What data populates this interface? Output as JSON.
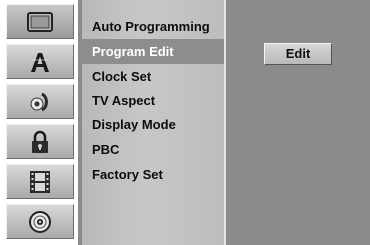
{
  "icons": [
    {
      "name": "tv-screen-icon",
      "active": true
    },
    {
      "name": "language-a-icon",
      "active": false
    },
    {
      "name": "audio-speaker-icon",
      "active": false
    },
    {
      "name": "lock-icon",
      "active": false
    },
    {
      "name": "film-strip-icon",
      "active": false
    },
    {
      "name": "disc-icon",
      "active": false
    }
  ],
  "menu": {
    "items": [
      {
        "label": "Auto Programming"
      },
      {
        "label": "Program Edit"
      },
      {
        "label": "Clock Set"
      },
      {
        "label": "TV Aspect"
      },
      {
        "label": "Display Mode"
      },
      {
        "label": "PBC"
      },
      {
        "label": "Factory Set"
      }
    ],
    "selected": "Program Edit"
  },
  "option": {
    "edit_label": "Edit"
  }
}
